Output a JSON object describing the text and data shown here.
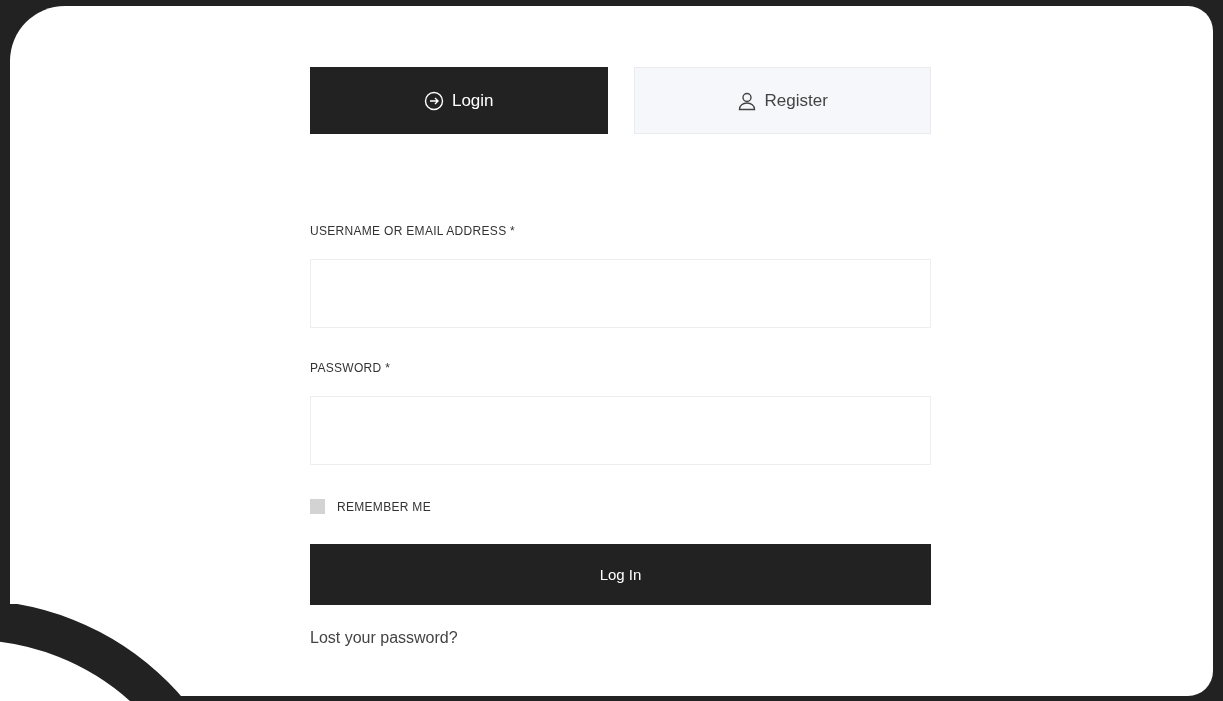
{
  "tabs": [
    {
      "label": "Login",
      "selected": true
    },
    {
      "label": "Register",
      "selected": false
    }
  ],
  "fields": [
    {
      "label": "USERNAME OR EMAIL ADDRESS *"
    },
    {
      "label": "PASSWORD *"
    }
  ],
  "remember": {
    "label": "REMEMBER ME",
    "checked": false
  },
  "submit": {
    "label": "Log In"
  },
  "lost_link": {
    "label": "Lost your password?"
  }
}
